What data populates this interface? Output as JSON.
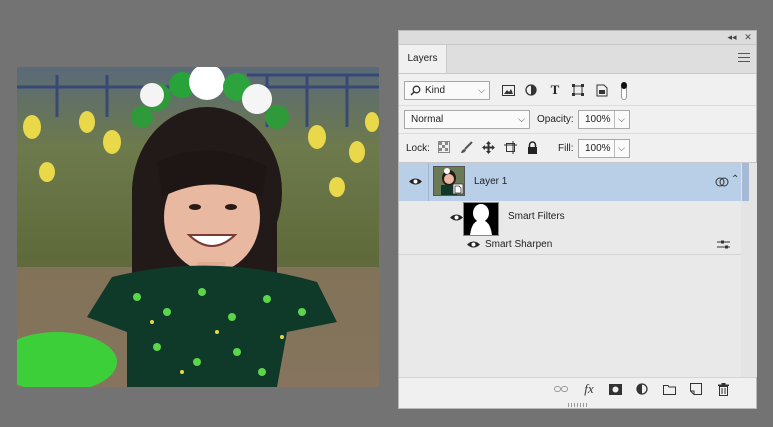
{
  "panel": {
    "collapse_icon": "double-chevron-icon",
    "close_icon": "close-icon",
    "tab_label": "Layers",
    "menu_icon": "hamburger-icon"
  },
  "filter": {
    "kind_label": "Kind",
    "kind_icon": "search-icon",
    "filter_icons": [
      "image-filter-icon",
      "adjustment-filter-icon",
      "type-filter-icon",
      "shape-filter-icon",
      "smart-object-filter-icon"
    ]
  },
  "blend": {
    "mode": "Normal",
    "opacity_label": "Opacity:",
    "opacity_value": "100%"
  },
  "lock": {
    "label": "Lock:",
    "fill_label": "Fill:",
    "fill_value": "100%"
  },
  "layers": [
    {
      "name": "Layer 1",
      "visible": true,
      "selected": true,
      "smart_filters_label": "Smart Filters",
      "filters": [
        {
          "name": "Smart Sharpen"
        }
      ]
    }
  ],
  "bottom_icons": [
    "link-layers-icon",
    "fx-icon",
    "add-mask-icon",
    "adjustment-layer-icon",
    "new-group-icon",
    "new-layer-icon",
    "delete-icon"
  ],
  "bottom_fx_text": "fx",
  "colors": {
    "selected_row": "#b9cfe8",
    "panel_bg": "#f0f0f0",
    "workspace_bg": "#737373"
  }
}
